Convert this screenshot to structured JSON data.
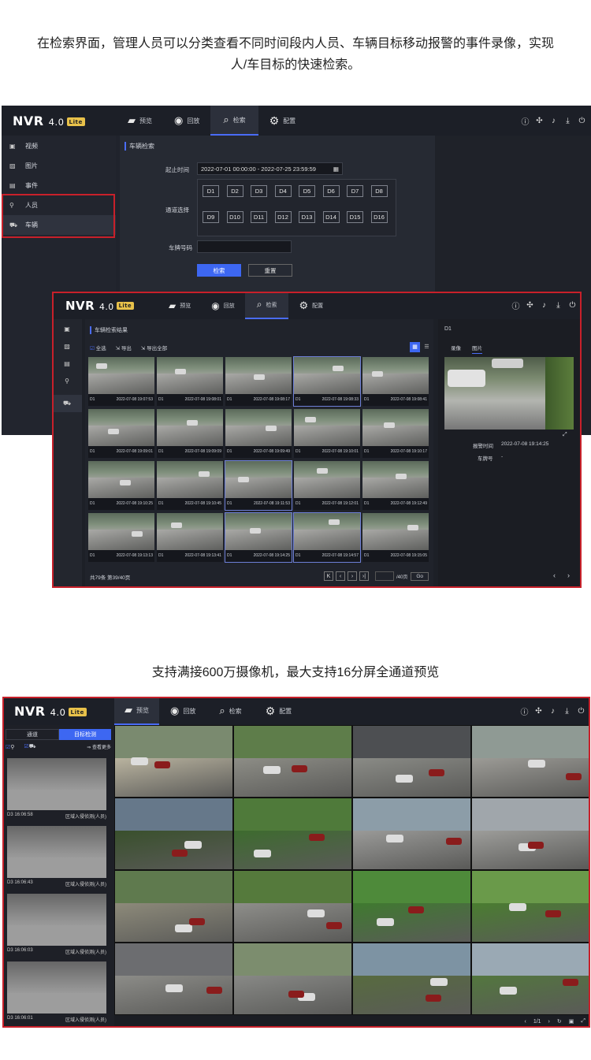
{
  "captions": {
    "intro": "在检索界面，管理人员可以分类查看不同时间段内人员、车辆目标移动报警的事件录像，实现人/车目标的快速检索。",
    "preview": "支持满接600万摄像机，最大支持16分屏全通道预览"
  },
  "nvr": {
    "logo": "NVR",
    "version": "4.0",
    "badge": "Lite",
    "tabs": [
      "预览",
      "回放",
      "检索",
      "配置"
    ],
    "icons": [
      "info-icon",
      "grid-icon",
      "bell-icon",
      "download-icon",
      "power-icon"
    ]
  },
  "search_screen": {
    "sidebar": [
      {
        "label": "视频",
        "icon": "video-icon"
      },
      {
        "label": "图片",
        "icon": "image-icon"
      },
      {
        "label": "事件",
        "icon": "event-icon"
      },
      {
        "label": "人员",
        "icon": "person-icon"
      },
      {
        "label": "车辆",
        "icon": "car-icon"
      }
    ],
    "section_title": "车辆检索",
    "time_label": "起止时间",
    "time_value": "2022-07-01 00:00:00 - 2022-07-25 23:59:59",
    "channel_label": "通道选择",
    "channels": [
      "D1",
      "D2",
      "D3",
      "D4",
      "D5",
      "D6",
      "D7",
      "D8",
      "D9",
      "D10",
      "D11",
      "D12",
      "D13",
      "D14",
      "D15",
      "D16"
    ],
    "plate_label": "车牌号码",
    "plate_value": "",
    "search_btn": "检索",
    "reset_btn": "重置"
  },
  "results_screen": {
    "title": "车辆检索结果",
    "select_all": "全选",
    "export": "导出",
    "export_all": "导出全部",
    "results": [
      {
        "ch": "D1",
        "time": "2022-07-08 19:07:53"
      },
      {
        "ch": "D1",
        "time": "2022-07-08 19:08:01"
      },
      {
        "ch": "D1",
        "time": "2022-07-08 19:08:17"
      },
      {
        "ch": "D1",
        "time": "2022-07-08 19:08:33"
      },
      {
        "ch": "D1",
        "time": "2022-07-08 19:08:41"
      },
      {
        "ch": "D1",
        "time": "2022-07-08 19:09:01"
      },
      {
        "ch": "D1",
        "time": "2022-07-08 19:09:09"
      },
      {
        "ch": "D1",
        "time": "2022-07-08 19:09:49"
      },
      {
        "ch": "D1",
        "time": "2022-07-08 19:10:01"
      },
      {
        "ch": "D1",
        "time": "2022-07-08 19:10:17"
      },
      {
        "ch": "D1",
        "time": "2022-07-08 19:10:25"
      },
      {
        "ch": "D1",
        "time": "2022-07-08 19:10:45"
      },
      {
        "ch": "D1",
        "time": "2022-07-08 19:11:53"
      },
      {
        "ch": "D1",
        "time": "2022-07-08 19:12:01"
      },
      {
        "ch": "D1",
        "time": "2022-07-08 19:12:49"
      },
      {
        "ch": "D1",
        "time": "2022-07-08 19:13:13"
      },
      {
        "ch": "D1",
        "time": "2022-07-08 19:13:41"
      },
      {
        "ch": "D1",
        "time": "2022-07-08 19:14:25"
      },
      {
        "ch": "D1",
        "time": "2022-07-08 19:14:57"
      },
      {
        "ch": "D1",
        "time": "2022-07-08 19:15:05"
      }
    ],
    "total": "共79条 第39/40页",
    "pager_page_suffix": "/40页",
    "go": "Go",
    "detail": {
      "channel": "D1",
      "tabs": [
        "录像",
        "图片"
      ],
      "alarm_time_label": "报警时间",
      "alarm_time": "2022-07-08 19:14:25",
      "plate_label": "车牌号",
      "plate": "-"
    }
  },
  "preview_screen": {
    "side_tabs": [
      "通道",
      "目标检测"
    ],
    "more": "查看更多",
    "events": [
      {
        "time": "D3 16:06:58",
        "type": "区域入侵侦测(人员)"
      },
      {
        "time": "D3 16:06:43",
        "type": "区域入侵侦测(人员)"
      },
      {
        "time": "D3 16:06:03",
        "type": "区域入侵侦测(人员)"
      },
      {
        "time": "D3 16:06:01",
        "type": "区域入侵侦测(人员)"
      }
    ],
    "page_indicator": "1/1"
  }
}
